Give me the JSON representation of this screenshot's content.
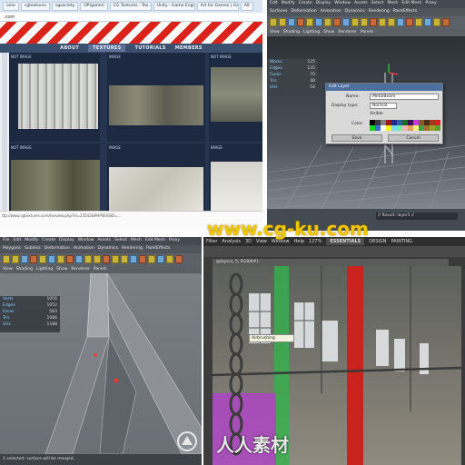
{
  "q1": {
    "url": ".com",
    "tabs": [
      "ome",
      "cgtextures",
      "cgsociety",
      "OP(game)",
      "CG Textures - Tex...",
      "Unity - Game Engine",
      "Art for Games | Gam...",
      "Alt"
    ],
    "nav": [
      "ABOUT",
      "TEXTURES",
      "TUTORIALS",
      "MEMBERS"
    ],
    "captions": [
      "NOT IMAGE",
      "IMAGE",
      "NOT IMAGE",
      "NOT IMAGE",
      "IMAGE",
      "IMAGE"
    ],
    "status": "ttp://www.cgtextures.com/texview.php?id=23542&PHPSESSID=..."
  },
  "q2": {
    "menu": [
      "Edit",
      "Modify",
      "Create",
      "Display",
      "Window",
      "Assets",
      "Select",
      "Mesh",
      "Edit Mesh",
      "Proxy",
      "Normals",
      "Color",
      "Create UVs",
      "Edit UVs",
      "Muscle"
    ],
    "shelf_tabs": [
      "Surfaces",
      "Deformation",
      "Animation",
      "Dynamics",
      "Rendering",
      "PaintEffects",
      "Toon",
      "Muscle",
      "Fluids"
    ],
    "view_menu": [
      "View",
      "Shading",
      "Lighting",
      "Show",
      "Renderer",
      "Panels"
    ],
    "channels": [
      {
        "label": "Works",
        "value": "125"
      },
      {
        "label": "Edges",
        "value": "135"
      },
      {
        "label": "Faces",
        "value": "70"
      },
      {
        "label": "Tris",
        "value": "48"
      },
      {
        "label": "UVs",
        "value": "54"
      }
    ],
    "dialog": {
      "title": "Edit Layer",
      "name_label": "Name:",
      "name_value": "MetalBeam",
      "display_label": "Display type:",
      "display_value": "Normal",
      "color_label": "Color:",
      "visible_label": "Visible",
      "save": "Save",
      "cancel": "Cancel"
    },
    "statusline": "// Result: layer1 //"
  },
  "q3": {
    "menu": [
      "File",
      "Edit",
      "Modify",
      "Create",
      "Display",
      "Window",
      "Assets",
      "Select",
      "Mesh",
      "Edit Mesh",
      "Proxy",
      "Normals",
      "Color",
      "Create UVs",
      "Edit UVs",
      "Muscle",
      "Help"
    ],
    "shelf_tabs": [
      "Polygons",
      "Subdivs",
      "Deformation",
      "Animation",
      "Dynamics",
      "Rendering",
      "PaintEffects",
      "Toon",
      "Muscle"
    ],
    "view_menu": [
      "View",
      "Shading",
      "Lighting",
      "Show",
      "Renderer",
      "Panels"
    ],
    "channels": [
      {
        "label": "Verts",
        "value": "1056"
      },
      {
        "label": "Edges",
        "value": "1052"
      },
      {
        "label": "Faces",
        "value": "583"
      },
      {
        "label": "Tris",
        "value": "1086"
      },
      {
        "label": "UVs",
        "value": "1188"
      }
    ],
    "statusline": "1 selected: surface will be merged."
  },
  "q4": {
    "menu": [
      "File",
      "Edit",
      "Image",
      "Layer",
      "Select",
      "Filter",
      "Analysis",
      "3D",
      "View",
      "Window",
      "Help"
    ],
    "zoom": "127%",
    "workspaces": [
      "ESSENTIALS",
      "DESIGN",
      "PAINTING"
    ],
    "doc_tab": "@layers, 5, RGB/8#)",
    "tooltip": "Airbrushing"
  },
  "watermarks": {
    "center": "www.cg-ku.com",
    "bottom": "人人素材"
  },
  "colors": {
    "stripe_red": "#d9231b",
    "nav_blue": "#3b4f6e",
    "maya_grey": "#5a5f66",
    "ps_dark": "#2e2e2e",
    "watermark_yellow": "#f2c600"
  }
}
